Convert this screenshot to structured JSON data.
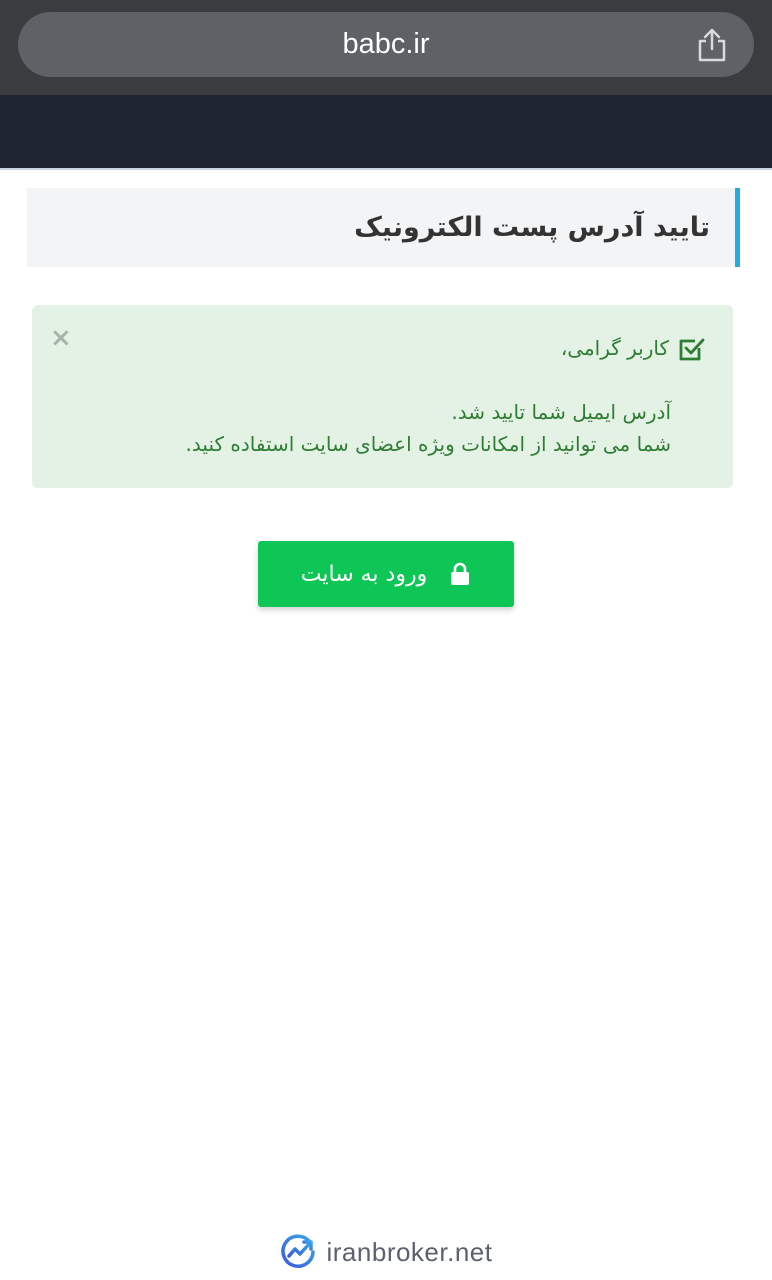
{
  "browser": {
    "url": "babc.ir"
  },
  "page": {
    "title": "تایید آدرس پست الکترونیک"
  },
  "alert": {
    "close_label": "×",
    "greeting": "کاربر گرامی،",
    "line1": "آدرس ایمیل شما تایید شد.",
    "line2": "شما می توانید از امکانات ویژه اعضای سایت استفاده کنید."
  },
  "actions": {
    "login_label": "ورود به سایت"
  },
  "footer": {
    "brand": "iranbroker.net"
  },
  "colors": {
    "header": "#1f2433",
    "accent": "#27a9e1",
    "alert_bg": "#e4f2e6",
    "alert_text": "#2e7d32",
    "button": "#0dc656"
  },
  "icons": {
    "share": "share-icon",
    "close": "close-icon",
    "check": "checkbox-check-icon",
    "lock": "lock-icon",
    "logo": "iranbroker-logo-icon"
  }
}
